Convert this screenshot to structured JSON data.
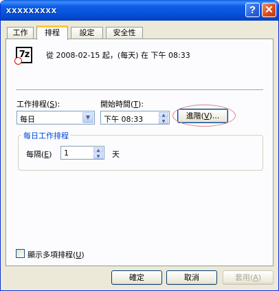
{
  "window": {
    "title": "xxxxxxxxx",
    "help_label": "?",
    "close_label": "✕"
  },
  "tabs": [
    {
      "label": "工作"
    },
    {
      "label": "排程",
      "active": true
    },
    {
      "label": "設定"
    },
    {
      "label": "安全性"
    }
  ],
  "task": {
    "icon": "7z-app-icon",
    "icon_text": "7z",
    "schedule_description": "從 2008-02-15 起，(每天) 在 下午 08:33"
  },
  "schedule": {
    "task_schedule_label_pre": "工作排程(",
    "task_schedule_label_key": "S",
    "task_schedule_label_post": "):",
    "task_schedule_value": "每日",
    "start_time_label_pre": "開始時間(",
    "start_time_label_key": "T",
    "start_time_label_post": "):",
    "start_time_value": "下午 08:33",
    "advanced_pre": "進階(",
    "advanced_key": "V",
    "advanced_post": ")..."
  },
  "daily_group": {
    "title": "每日工作排程",
    "every_pre": "每隔(",
    "every_key": "E",
    "every_post": ")",
    "interval_value": "1",
    "unit": "天"
  },
  "show_multiple": {
    "label_pre": "顯示多項排程(",
    "label_key": "U",
    "label_post": ")",
    "checked": false
  },
  "buttons": {
    "ok": "確定",
    "cancel": "取消",
    "apply_pre": "套用(",
    "apply_key": "A",
    "apply_post": ")"
  },
  "colors": {
    "titlebar": "#0855dd",
    "group_title": "#0046d5",
    "highlight_oval": "#e08080"
  }
}
